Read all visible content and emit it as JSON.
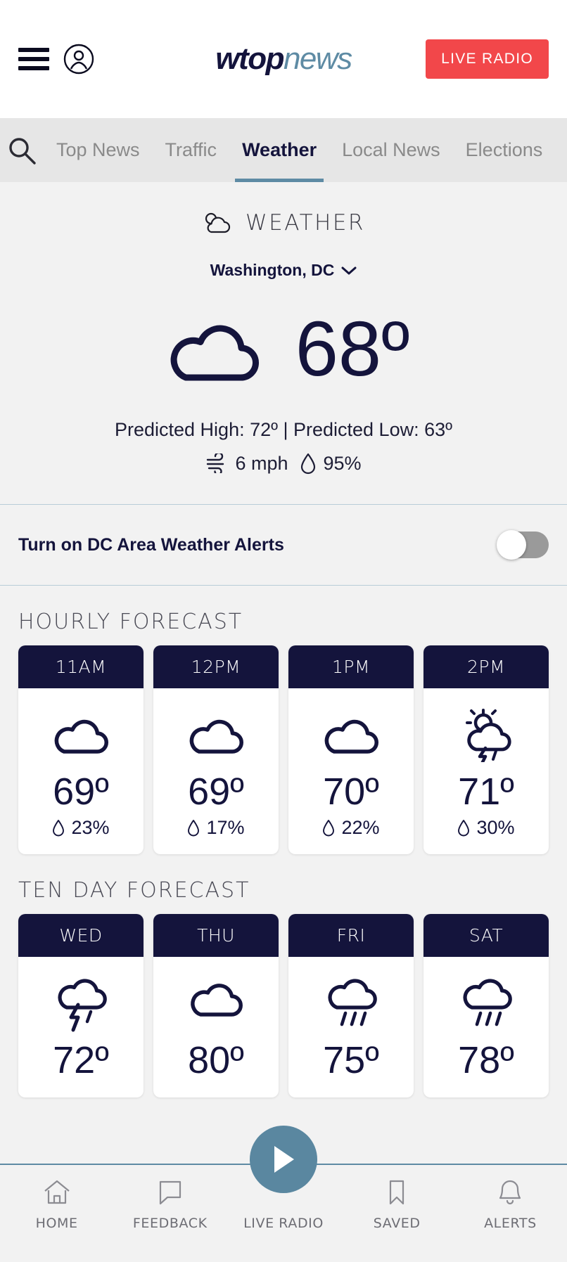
{
  "header": {
    "brand_primary": "wtop",
    "brand_secondary": "news",
    "live_radio_label": "LIVE RADIO",
    "menu_icon": "hamburger-icon",
    "account_icon": "user-account-icon"
  },
  "nav": {
    "search_icon": "search-icon",
    "items": [
      {
        "label": "Top News",
        "active": false
      },
      {
        "label": "Traffic",
        "active": false
      },
      {
        "label": "Weather",
        "active": true
      },
      {
        "label": "Local News",
        "active": false
      },
      {
        "label": "Elections",
        "active": false
      }
    ]
  },
  "weather": {
    "section_title": "WEATHER",
    "section_icon": "cloud-icon",
    "location": "Washington, DC",
    "location_chevron": "chevron-down-icon",
    "current_icon": "cloud-icon",
    "current_temp": "68º",
    "high_low": "Predicted High: 72º | Predicted Low: 63º",
    "wind_icon": "wind-icon",
    "wind": "6 mph",
    "humidity_icon": "droplet-icon",
    "humidity": "95%"
  },
  "alerts": {
    "label": "Turn on DC Area Weather Alerts",
    "toggle_state": "off"
  },
  "hourly": {
    "title": "HOURLY FORECAST",
    "cards": [
      {
        "time": "11AM",
        "icon": "cloud-icon",
        "temp": "69º",
        "precip": "23%",
        "precip_icon": "droplet-icon"
      },
      {
        "time": "12PM",
        "icon": "cloud-icon",
        "temp": "69º",
        "precip": "17%",
        "precip_icon": "droplet-icon"
      },
      {
        "time": "1PM",
        "icon": "cloud-icon",
        "temp": "70º",
        "precip": "22%",
        "precip_icon": "droplet-icon"
      },
      {
        "time": "2PM",
        "icon": "sun-cloud-lightning-icon",
        "temp": "71º",
        "precip": "30%",
        "precip_icon": "droplet-icon"
      }
    ]
  },
  "tenday": {
    "title": "TEN DAY FORECAST",
    "cards": [
      {
        "day": "WED",
        "icon": "cloud-lightning-rain-icon",
        "temp": "72º"
      },
      {
        "day": "THU",
        "icon": "cloud-icon",
        "temp": "80º"
      },
      {
        "day": "FRI",
        "icon": "cloud-rain-icon",
        "temp": "75º"
      },
      {
        "day": "SAT",
        "icon": "cloud-rain-icon",
        "temp": "78º"
      }
    ]
  },
  "bottom_nav": {
    "items": [
      {
        "label": "HOME",
        "icon": "home-icon"
      },
      {
        "label": "FEEDBACK",
        "icon": "speech-bubble-icon"
      },
      {
        "label": "LIVE RADIO",
        "icon": "play-icon"
      },
      {
        "label": "SAVED",
        "icon": "bookmark-icon"
      },
      {
        "label": "ALERTS",
        "icon": "bell-icon"
      }
    ]
  },
  "colors": {
    "navy": "#14143c",
    "accent_red": "#f2474a",
    "accent_teal": "#5e8ba4",
    "page_bg": "#f2f2f2"
  }
}
